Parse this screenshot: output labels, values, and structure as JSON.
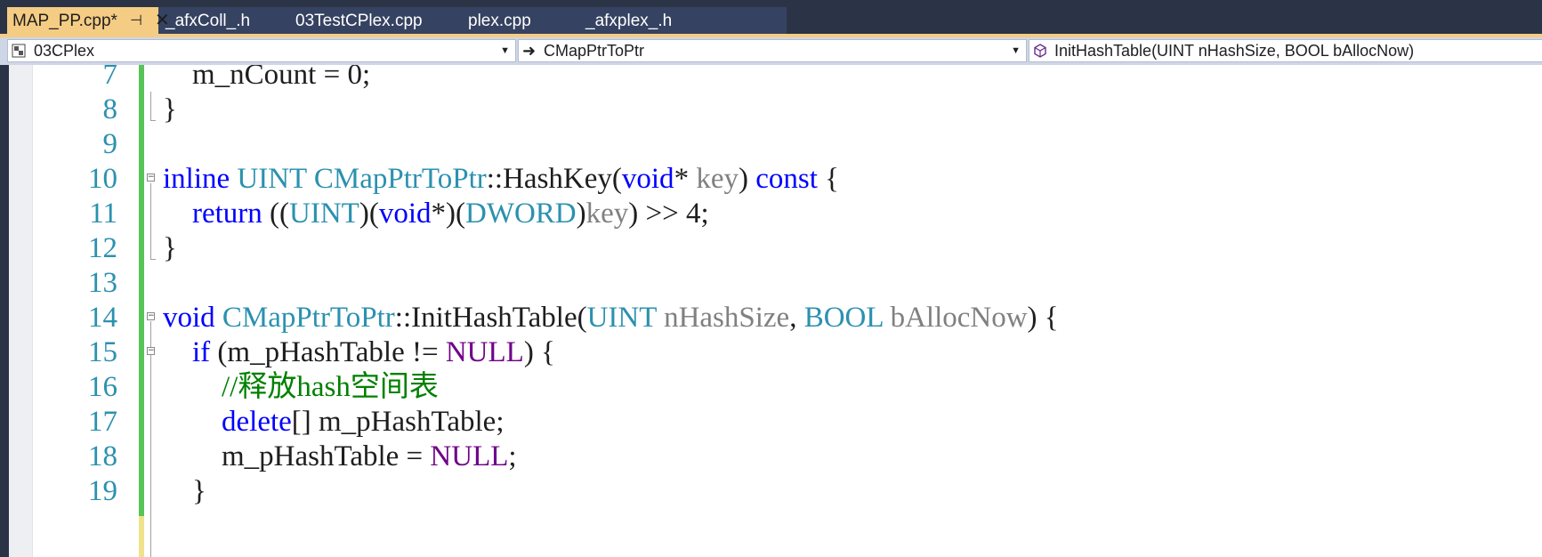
{
  "tabs": [
    {
      "label": "MAP_PP.cpp*",
      "active": true,
      "pin_icon": "pin-icon",
      "close_icon": "close-icon"
    },
    {
      "label": "_afxColl_.h"
    },
    {
      "label": "03TestCPlex.cpp"
    },
    {
      "label": "plex.cpp"
    },
    {
      "label": "_afxplex_.h"
    }
  ],
  "nav": {
    "project": "03CPlex",
    "class": "CMapPtrToPtr",
    "member": "InitHashTable(UINT nHashSize, BOOL bAllocNow)"
  },
  "lines": [
    {
      "num": "7",
      "indent": "    ",
      "tokens": [
        {
          "t": "m_nCount = 0;",
          "c": "pl"
        }
      ]
    },
    {
      "num": "8",
      "indent": "",
      "tokens": [
        {
          "t": "}",
          "c": "pl"
        }
      ]
    },
    {
      "num": "9",
      "indent": "",
      "tokens": []
    },
    {
      "num": "10",
      "indent": "",
      "fold": "⊟",
      "tokens": [
        {
          "t": "inline",
          "c": "kw"
        },
        {
          "t": " ",
          "c": "pl"
        },
        {
          "t": "UINT",
          "c": "ty"
        },
        {
          "t": " ",
          "c": "pl"
        },
        {
          "t": "CMapPtrToPtr",
          "c": "ty"
        },
        {
          "t": "::HashKey(",
          "c": "pl"
        },
        {
          "t": "void",
          "c": "kw"
        },
        {
          "t": "* ",
          "c": "pl"
        },
        {
          "t": "key",
          "c": "pm"
        },
        {
          "t": ") ",
          "c": "pl"
        },
        {
          "t": "const",
          "c": "kw"
        },
        {
          "t": " {",
          "c": "pl"
        }
      ]
    },
    {
      "num": "11",
      "indent": "    ",
      "tokens": [
        {
          "t": "return",
          "c": "kw"
        },
        {
          "t": " ((",
          "c": "pl"
        },
        {
          "t": "UINT",
          "c": "ty"
        },
        {
          "t": ")(",
          "c": "pl"
        },
        {
          "t": "void",
          "c": "kw"
        },
        {
          "t": "*)(",
          "c": "pl"
        },
        {
          "t": "DWORD",
          "c": "ty"
        },
        {
          "t": ")",
          "c": "pl"
        },
        {
          "t": "key",
          "c": "pm"
        },
        {
          "t": ") >> 4;",
          "c": "pl"
        }
      ]
    },
    {
      "num": "12",
      "indent": "",
      "tokens": [
        {
          "t": "}",
          "c": "pl"
        }
      ]
    },
    {
      "num": "13",
      "indent": "",
      "tokens": []
    },
    {
      "num": "14",
      "indent": "",
      "fold": "⊟",
      "tokens": [
        {
          "t": "void",
          "c": "kw"
        },
        {
          "t": " ",
          "c": "pl"
        },
        {
          "t": "CMapPtrToPtr",
          "c": "ty"
        },
        {
          "t": "::InitHashTable(",
          "c": "pl"
        },
        {
          "t": "UINT",
          "c": "ty"
        },
        {
          "t": " ",
          "c": "pl"
        },
        {
          "t": "nHashSize",
          "c": "pm"
        },
        {
          "t": ", ",
          "c": "pl"
        },
        {
          "t": "BOOL",
          "c": "ty"
        },
        {
          "t": " ",
          "c": "pl"
        },
        {
          "t": "bAllocNow",
          "c": "pm"
        },
        {
          "t": ") {",
          "c": "pl"
        }
      ]
    },
    {
      "num": "15",
      "indent": "    ",
      "fold": "⊟",
      "tokens": [
        {
          "t": "if",
          "c": "kw"
        },
        {
          "t": " (m_pHashTable != ",
          "c": "pl"
        },
        {
          "t": "NULL",
          "c": "mc"
        },
        {
          "t": ") {",
          "c": "pl"
        }
      ]
    },
    {
      "num": "16",
      "indent": "        ",
      "tokens": [
        {
          "t": "//释放hash空间表",
          "c": "cm"
        }
      ]
    },
    {
      "num": "17",
      "indent": "        ",
      "tokens": [
        {
          "t": "delete",
          "c": "kw"
        },
        {
          "t": "[] m_pHashTable;",
          "c": "pl"
        }
      ]
    },
    {
      "num": "18",
      "indent": "        ",
      "tokens": [
        {
          "t": "m_pHashTable = ",
          "c": "pl"
        },
        {
          "t": "NULL",
          "c": "mc"
        },
        {
          "t": ";",
          "c": "pl"
        }
      ]
    },
    {
      "num": "19",
      "indent": "    ",
      "tokens": [
        {
          "t": "}",
          "c": "pl"
        }
      ]
    }
  ],
  "colors": {
    "keyword": "#0000ff",
    "type": "#2b91af",
    "parameter": "#808080",
    "macro": "#6f008a",
    "comment": "#008000",
    "active_tab": "#f5cc84",
    "change_saved": "#57c457",
    "change_unsaved": "#f0e28a"
  }
}
